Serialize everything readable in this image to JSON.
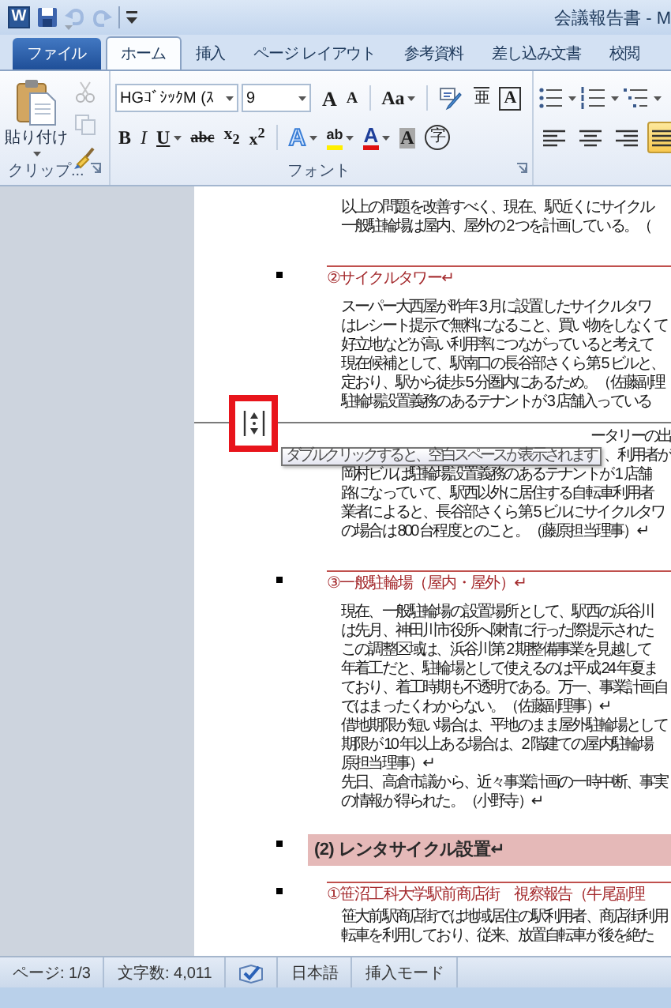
{
  "title_bar": {
    "app_icon": "W",
    "title": "会議報告書 - M"
  },
  "quick_access": [
    {
      "kind": "save",
      "disabled": false
    },
    {
      "kind": "undo",
      "disabled": true
    },
    {
      "kind": "redo",
      "disabled": true
    },
    {
      "kind": "customize",
      "disabled": false
    }
  ],
  "tabs": [
    {
      "label": "ファイル",
      "kind": "file",
      "selected": false
    },
    {
      "label": "ホーム",
      "kind": "tab",
      "selected": true
    },
    {
      "label": "挿入",
      "kind": "tab",
      "selected": false
    },
    {
      "label": "ページ レイアウト",
      "kind": "tab",
      "selected": false
    },
    {
      "label": "参考資料",
      "kind": "tab",
      "selected": false
    },
    {
      "label": "差し込み文書",
      "kind": "tab",
      "selected": false
    },
    {
      "label": "校閲",
      "kind": "tab",
      "selected": false
    }
  ],
  "ribbon": {
    "clipboard": {
      "paste_label": "貼り付け",
      "tools": [
        {
          "kind": "cut",
          "disabled": true
        },
        {
          "kind": "copy",
          "disabled": true
        },
        {
          "kind": "painter",
          "disabled": false
        }
      ],
      "group_label": "クリップ..."
    },
    "font": {
      "font_name": "HGｺﾞｼｯｸM (ｽ",
      "font_size": "9",
      "row_1": [
        {
          "kind": "grow",
          "label": "A"
        },
        {
          "kind": "shrink",
          "label": "A"
        },
        {
          "kind": "case",
          "label": "Aa"
        },
        {
          "kind": "phonetic"
        },
        {
          "kind": "guide",
          "label": "亜"
        },
        {
          "kind": "border",
          "label": "A"
        }
      ],
      "row_2": [
        {
          "kind": "bold",
          "label": "B"
        },
        {
          "kind": "italic",
          "label": "I"
        },
        {
          "kind": "underline",
          "label": "U"
        },
        {
          "kind": "strike",
          "label": "abc"
        },
        {
          "kind": "sub",
          "label": "x$_{2}$"
        },
        {
          "kind": "sup",
          "label": "x$^{2}$"
        },
        {
          "kind": "effects",
          "label": "A"
        },
        {
          "kind": "highlight",
          "label": "ab"
        },
        {
          "kind": "color",
          "label": "A"
        },
        {
          "kind": "shading",
          "label": "A"
        },
        {
          "kind": "enclose",
          "label": "字"
        }
      ],
      "group_label": "フォント"
    },
    "paragraph": {
      "lists": [
        {
          "kind": "bullets"
        },
        {
          "kind": "numbering"
        },
        {
          "kind": "multilevel"
        }
      ],
      "align": [
        {
          "kind": "left",
          "selected": false
        },
        {
          "kind": "center",
          "selected": false
        },
        {
          "kind": "right",
          "selected": false
        },
        {
          "kind": "justify",
          "selected": true
        }
      ]
    }
  },
  "document": {
    "pages": [
      {
        "blocks": [
          {
            "kind": "body",
            "lines": [
              "以上の問題を改善すべく、現在、駅近くにサイクル",
              "一般駐輪場は屋内、屋外の 2 つを計画している。（"
            ]
          },
          {
            "kind": "heading",
            "text": "②サイクルタワー↵"
          },
          {
            "kind": "body",
            "lines": [
              "スーパー大西屋が昨年 3 月に設置したサイクルタワ",
              "はレシート提示で無料になること、買い物をしなくて",
              "好立地などが高い利用率につながっていると考えて",
              "現在候補として、駅南口の長谷部さくら第 5 ビルと、",
              "定おり、駅から徒歩 5 分圏内にあるため。（佐藤副理",
              "駐輪場設置義務のあるテナントが 3 店舗入っている"
            ]
          }
        ]
      },
      {
        "blocks": [
          {
            "kind": "covered",
            "lines": [
              "ータリーの出",
              "、利用者が"
            ]
          },
          {
            "kind": "body",
            "lines": [
              "岡村ビルは駐輪場設置義務のあるテナントが 1 店舗",
              "路になっていて、駅西以外に居住する自転車利用者",
              "業者によると、長谷部さくら第 5 ビルにサイクルタワ",
              "の場合は 800 台程度とのこと。（藤原担当理事）↵"
            ]
          },
          {
            "kind": "heading",
            "text": "③一般駐輪場（屋内・屋外）↵"
          },
          {
            "kind": "body",
            "lines": [
              "現在、一般駐輪場の設置場所として、駅西の浜谷川",
              "は先月、神田川市役所へ陳情に行った際提示された",
              "この調整区域は、浜谷川第 2 期整備事業を見越して",
              "年着工だと、駐輪場として使えるのは平成 24 年夏ま",
              "ており、着工時期も不透明である。万一、事業計画自",
              "ではまったくわからない。（佐藤副理事）↵",
              "借地期限が短い場合は、平地のまま屋外駐輪場として",
              "期限が 10 年以上ある場合は、2 階建ての屋内駐輪場",
              "原担当理事）↵",
              "先日、高倉市議から、近々事業計画の一時中断、事実",
              "の情報が得られた。（小野寺）↵"
            ]
          },
          {
            "kind": "section",
            "text": "(2) レンタサイクル設置↵"
          },
          {
            "kind": "heading",
            "text": "①笹沼工科大学駅前商店街　視察報告（牛尾副理"
          },
          {
            "kind": "body",
            "lines": [
              "笹大前駅商店街では地域居住の駅利用者、商店街利用",
              "転車を利用しており、従来、放置自転車が後を絶た"
            ]
          }
        ]
      }
    ],
    "tooltip": {
      "text": "ダブルクリックすると、空白スペースが表示されます"
    }
  },
  "status_bar": [
    {
      "kind": "text",
      "label": "ページ: 1/3"
    },
    {
      "kind": "text",
      "label": "文字数: 4,011"
    },
    {
      "kind": "spellcheck"
    },
    {
      "kind": "text",
      "label": "日本語"
    },
    {
      "kind": "text",
      "label": "挿入モード"
    }
  ]
}
